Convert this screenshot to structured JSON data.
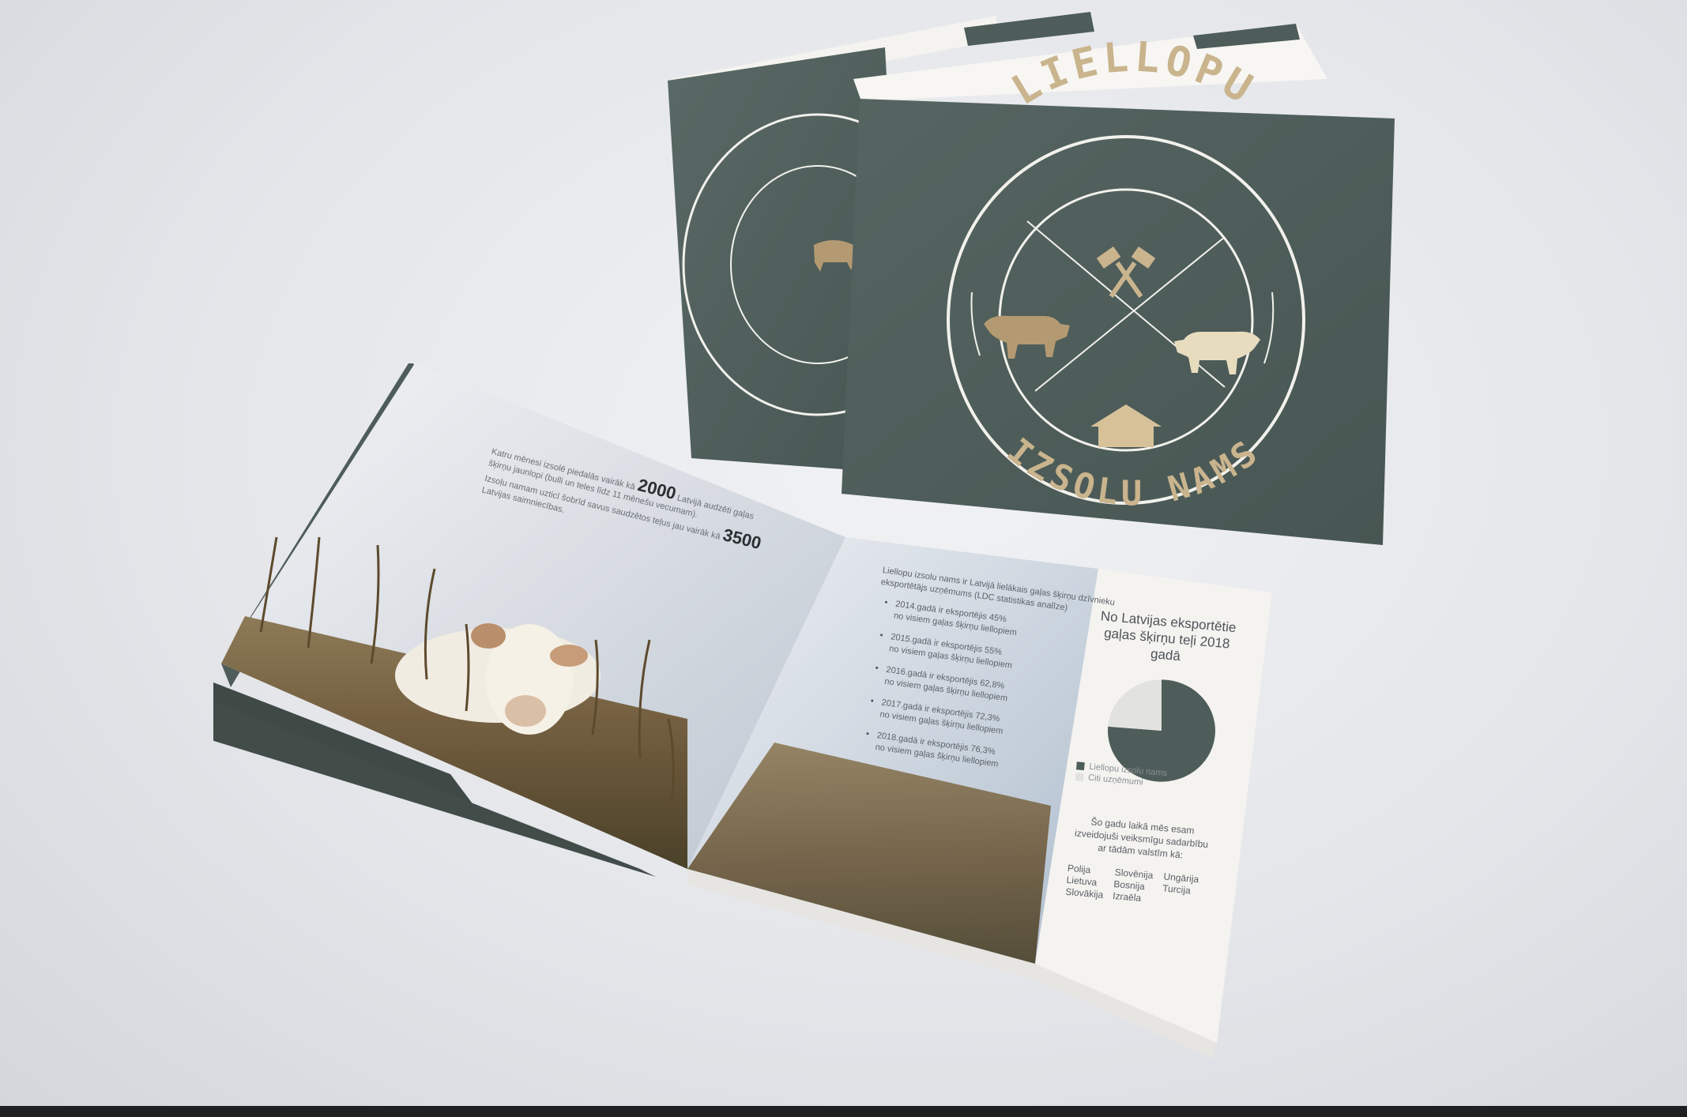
{
  "cover": {
    "logo_top": "LIELLOPU",
    "logo_bottom": "IZSOLU NAMS",
    "colors": {
      "cover": "#4e5d59",
      "emblem": "#c9b48e",
      "line": "#f2f1ec"
    },
    "emblem_icons": [
      "hammers-icon",
      "bull-icon",
      "cow-icon",
      "barn-icon"
    ]
  },
  "left_page": {
    "intro_line_1": "Katru mēnesi izsolē piedalās vairāk kā",
    "stat_1": "2000",
    "intro_line_1b": "Latvijā audzēti gaļas",
    "intro_line_2": "šķirņu jaunlopi (bulli un teles līdz 11 mēnešu vecumam).",
    "intro_line_3": "Izsoļu namam uzticī šobrīd savus saudzētos teļus jau vairāk kā",
    "stat_2": "3500",
    "intro_line_4": "Latvijas saimniecības."
  },
  "middle_page": {
    "intro": [
      "Liellopu izsolu nams ir Latvijā lielākais gaļas šķirņu dzīvnieku",
      "eksportētājs uzņēmums (LDC statistikas analīze)"
    ],
    "bullets": [
      [
        "2014.gadā ir eksportējis 45%",
        "no visiem gaļas šķirņu liellopiem"
      ],
      [
        "2015.gadā ir eksportējis 55%",
        "no visiem gaļas šķirņu liellopiem"
      ],
      [
        "2016.gadā ir eksportējis 62,8%",
        "no visiem gaļas šķirņu liellopiem"
      ],
      [
        "2017.gadā ir eksportējis 72,3%",
        "no visiem gaļas šķirņu liellopiem"
      ],
      [
        "2018.gadā ir eksportējis 76,3%",
        "no visiem gaļas šķirņu liellopiem"
      ]
    ]
  },
  "right_page": {
    "chart_title": "No Latvijas eksportētie gaļas šķirņu teļi 2018 gadā",
    "legend": [
      {
        "label": "Liellopu izsolu nams",
        "color": "#4e5d59"
      },
      {
        "label": "Citi uzņēmumi",
        "color": "#e2e2df"
      }
    ],
    "partners_intro": "Šo gadu laikā mēs esam izveidojuši veiksmīgu sadarbību ar tādām valstīm kā:",
    "countries": [
      "Polija",
      "Lietuva",
      "Slovākija",
      "Slovēnija",
      "Bosnija",
      "Izraēla",
      "Ungārija",
      "Turcija"
    ]
  },
  "chart_data": {
    "type": "pie",
    "title": "No Latvijas eksportētie gaļas šķirņu teļi 2018 gadā",
    "series": [
      {
        "name": "Liellopu izsolu nams",
        "value": 76.3
      },
      {
        "name": "Citi uzņēmumi",
        "value": 23.7
      }
    ]
  }
}
